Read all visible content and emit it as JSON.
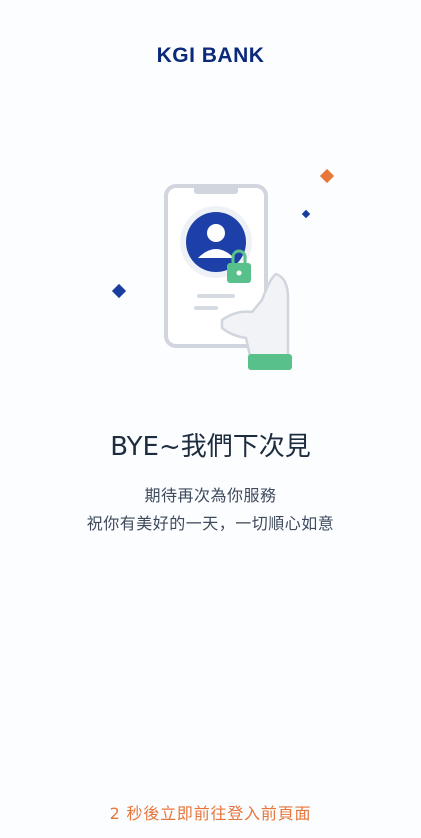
{
  "brand": {
    "name": "KGI BANK"
  },
  "message": {
    "title": "BYE~我們下次見",
    "line1": "期待再次為你服務",
    "line2": "祝你有美好的一天，一切順心如意"
  },
  "footer": {
    "countdown_text": "2 秒後立即前往登入前頁面"
  },
  "colors": {
    "brand_navy": "#0b2a7a",
    "accent_orange": "#e8753a",
    "accent_green": "#58c08a",
    "text_dark": "#1e2c3f",
    "text_body": "#3f4a5c"
  },
  "icons": [
    "phone-illustration",
    "user-avatar-icon",
    "lock-icon",
    "hand-illustration",
    "diamond-icon"
  ]
}
